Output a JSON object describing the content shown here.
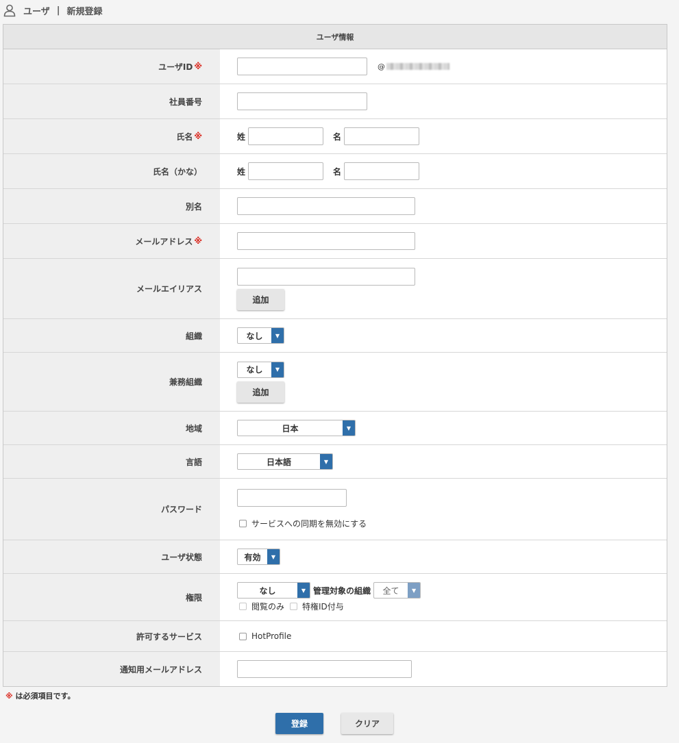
{
  "breadcrumb": {
    "section": "ユーザ",
    "separator": "|",
    "page": "新規登録",
    "icon": "user-icon"
  },
  "table": {
    "title": "ユーザ情報"
  },
  "required_mark": "※",
  "fields": {
    "user_id": {
      "label": "ユーザID",
      "value": "",
      "domain_prefix": "@"
    },
    "employee_no": {
      "label": "社員番号",
      "value": ""
    },
    "name": {
      "label": "氏名",
      "last_prefix": "姓",
      "first_prefix": "名",
      "last_value": "",
      "first_value": ""
    },
    "name_kana": {
      "label": "氏名（かな）",
      "last_prefix": "姓",
      "first_prefix": "名",
      "last_value": "",
      "first_value": ""
    },
    "alias": {
      "label": "別名",
      "value": ""
    },
    "email": {
      "label": "メールアドレス",
      "value": ""
    },
    "email_alias": {
      "label": "メールエイリアス",
      "value": "",
      "add_label": "追加"
    },
    "organization": {
      "label": "組織",
      "selected": "なし"
    },
    "concurrent_org": {
      "label": "兼務組織",
      "selected": "なし",
      "add_label": "追加"
    },
    "region": {
      "label": "地域",
      "selected": "日本"
    },
    "language": {
      "label": "言語",
      "selected": "日本語"
    },
    "password": {
      "label": "パスワード",
      "value": "",
      "disable_sync_label": "サービスへの同期を無効にする",
      "disable_sync_checked": false
    },
    "user_status": {
      "label": "ユーザ状態",
      "selected": "有効"
    },
    "permission": {
      "label": "権限",
      "selected": "なし",
      "managed_org_label": "管理対象の組織",
      "managed_org_selected": "全て",
      "view_only_label": "閲覧のみ",
      "privileged_id_label": "特権ID付与"
    },
    "allowed_services": {
      "label": "許可するサービス",
      "hotprofile_label": "HotProfile",
      "hotprofile_checked": false
    },
    "notify_email": {
      "label": "通知用メールアドレス",
      "value": ""
    }
  },
  "footer": {
    "required_note": "は必須項目です。",
    "register_label": "登録",
    "clear_label": "クリア"
  },
  "colors": {
    "accent": "#2f6faa",
    "required": "#d9261c"
  }
}
